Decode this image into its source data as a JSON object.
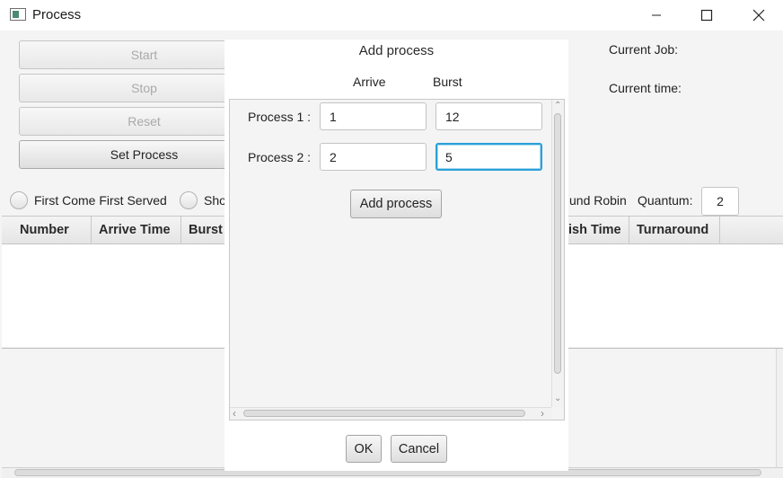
{
  "window": {
    "title": "Process",
    "controls": [
      "minimize-icon",
      "maximize-icon",
      "close-icon"
    ]
  },
  "left_buttons": {
    "start": "Start",
    "stop": "Stop",
    "reset": "Reset",
    "set_process": "Set Process"
  },
  "status": {
    "current_job_label": "Current Job:",
    "current_time_label": "Current time:"
  },
  "algorithms": {
    "fcfs": "First Come First Served",
    "shortest_partial": "Sho",
    "round_robin_partial": "und Robin",
    "quantum_label": "Quantum:",
    "quantum_value": "2"
  },
  "table": {
    "columns": [
      "Number",
      "Arrive Time",
      "Burst",
      "ish Time",
      "Turnaround"
    ]
  },
  "dialog": {
    "title": "Add process",
    "col_arrive": "Arrive",
    "col_burst": "Burst",
    "rows": [
      {
        "label": "Process 1 :",
        "arrive": "1",
        "burst": "12"
      },
      {
        "label": "Process 2 :",
        "arrive": "2",
        "burst": "5"
      }
    ],
    "add_button": "Add process",
    "ok_button": "OK",
    "cancel_button": "Cancel"
  },
  "colors": {
    "focus_accent": "#2ba0d8",
    "window_bg": "#f4f4f4",
    "dialog_bg": "#ffffff"
  }
}
